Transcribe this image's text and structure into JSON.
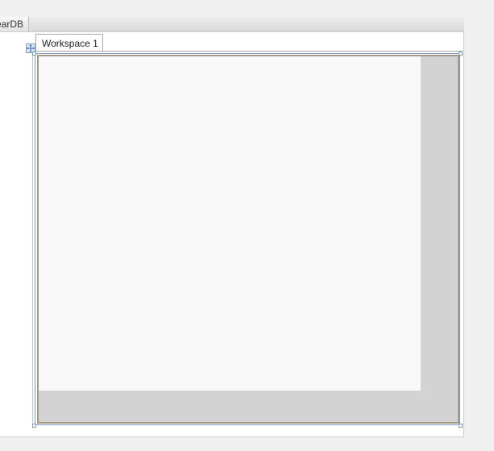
{
  "window": {
    "title_fragment": "earDB"
  },
  "workspace": {
    "tab_label": "Workspace 1"
  },
  "icons": {
    "move_handle": "move-arrows-icon"
  },
  "colors": {
    "canvas": "#f9f9fa",
    "scroll_area": "#d3d3d3",
    "frame_border": "#a39a86",
    "selection": "#7f9bc2"
  }
}
